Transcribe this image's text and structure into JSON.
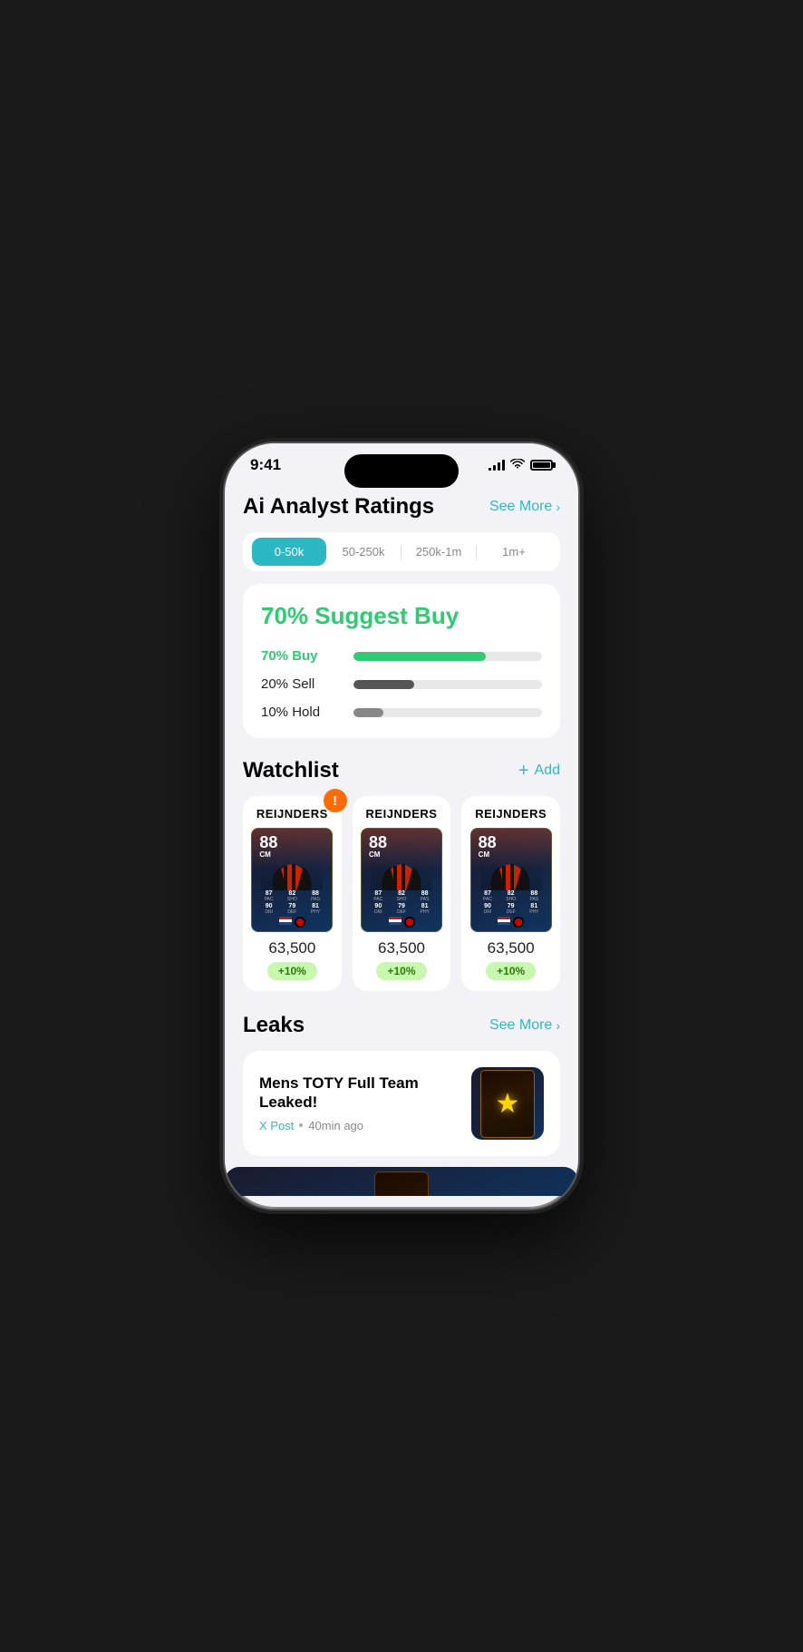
{
  "status_bar": {
    "time": "9:41",
    "signal_bars": [
      3,
      6,
      9,
      12
    ],
    "wifi": "wifi",
    "battery": "battery"
  },
  "analyst_ratings": {
    "title": "Ai Analyst Ratings",
    "see_more": "See More",
    "filters": [
      {
        "label": "0-50k",
        "active": true
      },
      {
        "label": "50-250k",
        "active": false
      },
      {
        "label": "250k-1m",
        "active": false
      },
      {
        "label": "1m+",
        "active": false
      }
    ],
    "suggest_text": "70% Suggest Buy",
    "stats": [
      {
        "label": "70% Buy",
        "width": 70,
        "type": "buy"
      },
      {
        "label": "20% Sell",
        "width": 32,
        "type": "sell"
      },
      {
        "label": "10% Hold",
        "width": 16,
        "type": "hold"
      }
    ]
  },
  "watchlist": {
    "title": "Watchlist",
    "add_label": "Add",
    "players": [
      {
        "name": "REIJNDERS",
        "rating": "88",
        "position": "CM",
        "price": "63,500",
        "change": "+10%",
        "has_alert": true,
        "stats": [
          {
            "val": "87",
            "key": "PAC"
          },
          {
            "val": "82",
            "key": "SHO"
          },
          {
            "val": "88",
            "key": "PAS"
          },
          {
            "val": "90",
            "key": "DRI"
          },
          {
            "val": "79",
            "key": "DEF"
          },
          {
            "val": "81",
            "key": "PHY"
          }
        ]
      },
      {
        "name": "REIJNDERS",
        "rating": "88",
        "position": "CM",
        "price": "63,500",
        "change": "+10%",
        "has_alert": false,
        "stats": [
          {
            "val": "87",
            "key": "PAC"
          },
          {
            "val": "82",
            "key": "SHO"
          },
          {
            "val": "88",
            "key": "PAS"
          },
          {
            "val": "90",
            "key": "DRI"
          },
          {
            "val": "79",
            "key": "DEF"
          },
          {
            "val": "81",
            "key": "PHY"
          }
        ]
      },
      {
        "name": "REIJNDERS",
        "rating": "88",
        "position": "CM",
        "price": "63,500",
        "change": "+10%",
        "has_alert": false,
        "stats": [
          {
            "val": "87",
            "key": "PAC"
          },
          {
            "val": "82",
            "key": "SHO"
          },
          {
            "val": "88",
            "key": "PAS"
          },
          {
            "val": "90",
            "key": "DRI"
          },
          {
            "val": "79",
            "key": "DEF"
          },
          {
            "val": "81",
            "key": "PHY"
          }
        ]
      }
    ]
  },
  "leaks": {
    "title": "Leaks",
    "see_more": "See More",
    "items": [
      {
        "title": "Mens TOTY Full Team Leaked!",
        "source": "X Post",
        "time": "40min ago"
      }
    ]
  }
}
